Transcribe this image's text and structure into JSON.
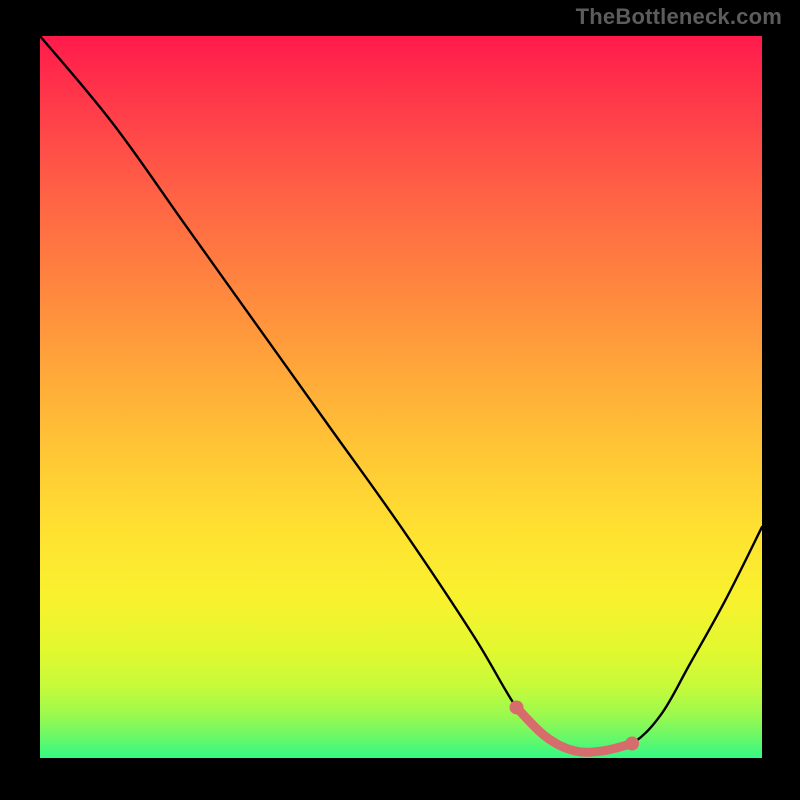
{
  "attribution": "TheBottleneck.com",
  "chart_data": {
    "type": "line",
    "title": "",
    "xlabel": "",
    "ylabel": "",
    "xlim": [
      0,
      100
    ],
    "ylim": [
      0,
      100
    ],
    "curve_description": "Bottleneck V-curve on red-yellow-green gradient. Steep linear descent from upper-left to a flat minimum plateau near x≈68–82, then a rise toward the upper-right. The plateau segment is overdrawn with a thick salmon stroke + endpoint dots.",
    "series": [
      {
        "name": "main-curve",
        "color": "#000000",
        "x": [
          0,
          10,
          20,
          30,
          40,
          50,
          60,
          66,
          70,
          74,
          78,
          82,
          86,
          90,
          95,
          100
        ],
        "y": [
          100,
          88,
          74,
          60,
          46,
          32,
          17,
          7,
          3,
          1,
          1,
          2,
          6,
          13,
          22,
          32
        ]
      },
      {
        "name": "plateau-highlight",
        "color": "#d76c6c",
        "x": [
          66,
          70,
          74,
          78,
          82
        ],
        "y": [
          7,
          3,
          1,
          1,
          2
        ],
        "marker_endpoints": true
      }
    ]
  }
}
